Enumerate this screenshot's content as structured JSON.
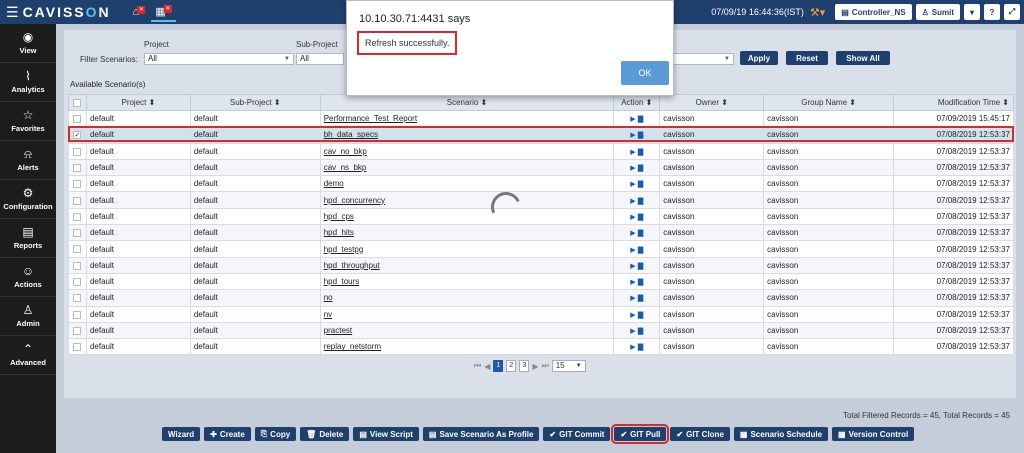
{
  "topbar": {
    "brand_prefix": "CAVISS",
    "brand_o": "O",
    "brand_suffix": "N",
    "datetime": "07/09/19 16:44:36(IST)",
    "controller": "Controller_NS",
    "user": "Sumit"
  },
  "sidebar": [
    {
      "label": "View",
      "icon": "eye-icon",
      "glyph": "◉"
    },
    {
      "label": "Analytics",
      "icon": "line-chart-icon",
      "glyph": "⌇"
    },
    {
      "label": "Favorites",
      "icon": "star-icon",
      "glyph": "☆"
    },
    {
      "label": "Alerts",
      "icon": "bell-icon",
      "glyph": "⍾"
    },
    {
      "label": "Configuration",
      "icon": "gears-icon",
      "glyph": "⚙"
    },
    {
      "label": "Reports",
      "icon": "document-icon",
      "glyph": "▤"
    },
    {
      "label": "Actions",
      "icon": "user-circle-icon",
      "glyph": "☺"
    },
    {
      "label": "Admin",
      "icon": "user-icon",
      "glyph": "♙"
    },
    {
      "label": "Advanced",
      "icon": "chevron-up-circle-icon",
      "glyph": "⌃"
    }
  ],
  "filter": {
    "label": "Filter Scenarios:",
    "project_label": "Project",
    "project_value": "All",
    "subproject_label": "Sub-Project",
    "subproject_value": "All",
    "apply": "Apply",
    "reset": "Reset",
    "show_all": "Show All"
  },
  "section_label": "Available Scenario(s)",
  "table": {
    "columns": [
      "Project",
      "Sub-Project",
      "Scenario",
      "Action",
      "Owner",
      "Group Name",
      "Modification Time"
    ],
    "rows": [
      {
        "project": "default",
        "subproject": "default",
        "scenario": "Performance_Test_Report",
        "owner": "cavisson",
        "group": "cavisson",
        "time": "07/09/2019 15:45:17",
        "checked": false
      },
      {
        "project": "default",
        "subproject": "default",
        "scenario": "bh_data_specs",
        "owner": "cavisson",
        "group": "cavisson",
        "time": "07/08/2019 12:53:37",
        "checked": true
      },
      {
        "project": "default",
        "subproject": "default",
        "scenario": "cav_no_bkp",
        "owner": "cavisson",
        "group": "cavisson",
        "time": "07/08/2019 12:53:37",
        "checked": false
      },
      {
        "project": "default",
        "subproject": "default",
        "scenario": "cav_ns_bkp",
        "owner": "cavisson",
        "group": "cavisson",
        "time": "07/08/2019 12:53:37",
        "checked": false
      },
      {
        "project": "default",
        "subproject": "default",
        "scenario": "demo",
        "owner": "cavisson",
        "group": "cavisson",
        "time": "07/08/2019 12:53:37",
        "checked": false
      },
      {
        "project": "default",
        "subproject": "default",
        "scenario": "hpd_concurrency",
        "owner": "cavisson",
        "group": "cavisson",
        "time": "07/08/2019 12:53:37",
        "checked": false
      },
      {
        "project": "default",
        "subproject": "default",
        "scenario": "hpd_cps",
        "owner": "cavisson",
        "group": "cavisson",
        "time": "07/08/2019 12:53:37",
        "checked": false
      },
      {
        "project": "default",
        "subproject": "default",
        "scenario": "hpd_hits",
        "owner": "cavisson",
        "group": "cavisson",
        "time": "07/08/2019 12:53:37",
        "checked": false
      },
      {
        "project": "default",
        "subproject": "default",
        "scenario": "hpd_testpg",
        "owner": "cavisson",
        "group": "cavisson",
        "time": "07/08/2019 12:53:37",
        "checked": false
      },
      {
        "project": "default",
        "subproject": "default",
        "scenario": "hpd_throughput",
        "owner": "cavisson",
        "group": "cavisson",
        "time": "07/08/2019 12:53:37",
        "checked": false
      },
      {
        "project": "default",
        "subproject": "default",
        "scenario": "hpd_tours",
        "owner": "cavisson",
        "group": "cavisson",
        "time": "07/08/2019 12:53:37",
        "checked": false
      },
      {
        "project": "default",
        "subproject": "default",
        "scenario": "no",
        "owner": "cavisson",
        "group": "cavisson",
        "time": "07/08/2019 12:53:37",
        "checked": false
      },
      {
        "project": "default",
        "subproject": "default",
        "scenario": "nv",
        "owner": "cavisson",
        "group": "cavisson",
        "time": "07/08/2019 12:53:37",
        "checked": false
      },
      {
        "project": "default",
        "subproject": "default",
        "scenario": "practest",
        "owner": "cavisson",
        "group": "cavisson",
        "time": "07/08/2019 12:53:37",
        "checked": false
      },
      {
        "project": "default",
        "subproject": "default",
        "scenario": "replay_netstorm",
        "owner": "cavisson",
        "group": "cavisson",
        "time": "07/08/2019 12:53:37",
        "checked": false
      }
    ]
  },
  "pager": {
    "pages": [
      "1",
      "2",
      "3"
    ],
    "current": "1",
    "page_size": "15"
  },
  "totals": "Total Filtered Records = 45, Total Records = 45",
  "actions": [
    {
      "label": "Wizard",
      "icon": "",
      "name": "wizard-button"
    },
    {
      "label": "Create",
      "icon": "✚",
      "name": "create-button"
    },
    {
      "label": "Copy",
      "icon": "⎘",
      "name": "copy-button"
    },
    {
      "label": "Delete",
      "icon": "🗑",
      "name": "delete-button"
    },
    {
      "label": "View Script",
      "icon": "▤",
      "name": "view-script-button"
    },
    {
      "label": "Save Scenario As Profile",
      "icon": "▤",
      "name": "save-scenario-profile-button"
    },
    {
      "label": "GIT Commit",
      "icon": "✔",
      "name": "git-commit-button"
    },
    {
      "label": "GIT Pull",
      "icon": "✔",
      "name": "git-pull-button"
    },
    {
      "label": "GIT Clone",
      "icon": "✔",
      "name": "git-clone-button"
    },
    {
      "label": "Scenario Schedule",
      "icon": "▦",
      "name": "scenario-schedule-button"
    },
    {
      "label": "Version Control",
      "icon": "▦",
      "name": "version-control-button"
    }
  ],
  "dialog": {
    "title": "10.10.30.71:4431 says",
    "message": "Refresh successfully.",
    "ok": "OK"
  }
}
